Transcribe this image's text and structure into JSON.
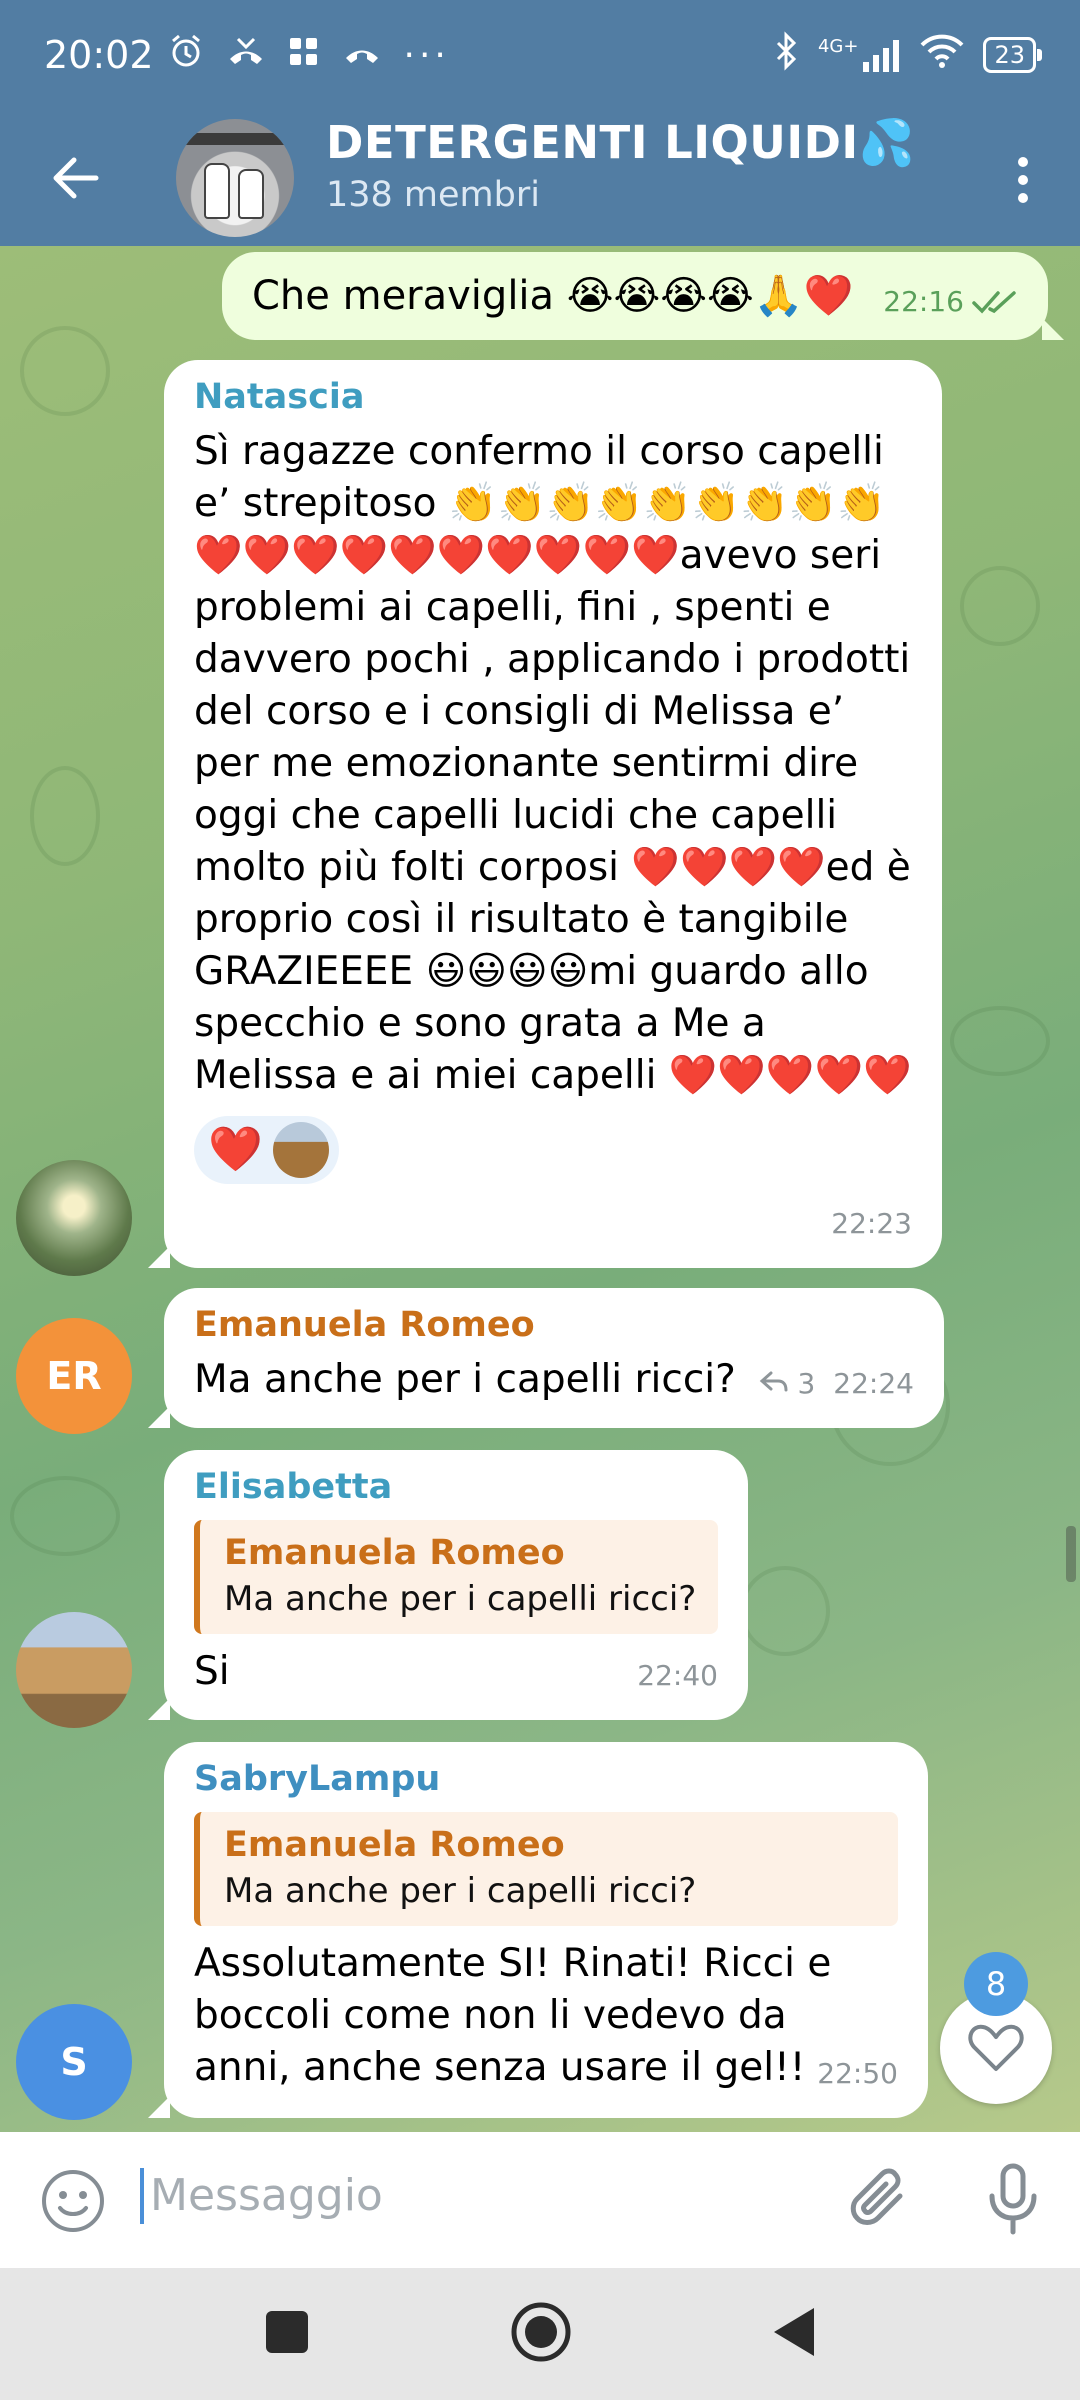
{
  "status_bar": {
    "time": "20:02",
    "network": "4G+",
    "battery": "23"
  },
  "header": {
    "title": "DETERGENTI LIQUIDI💦",
    "subtitle": "138 membri"
  },
  "messages": [
    {
      "type": "outgoing",
      "text": "Che meraviglia 😭😭😭😭🙏❤️",
      "time": "22:16"
    },
    {
      "type": "incoming",
      "sender": "Natascia",
      "sender_color": "#3f9dc0",
      "text": "Sì ragazze confermo il corso capelli e’ strepitoso 👏👏👏👏👏👏👏👏👏❤️❤️❤️❤️❤️❤️❤️❤️❤️❤️avevo seri problemi ai capelli, fini , spenti e davvero pochi , applicando i prodotti del corso e i consigli di Melissa e’ per me emozionante sentirmi dire oggi che capelli lucidi che capelli molto più folti corposi ❤️❤️❤️❤️ed è proprio così il risultato è tangibile GRAZIEEEE 😃😃😃😃mi guardo allo specchio e sono grata a Me a Melissa e ai miei capelli ❤️❤️❤️❤️❤️",
      "reaction": "❤️",
      "time": "22:23"
    },
    {
      "type": "incoming",
      "sender": "Emanuela Romeo",
      "sender_color": "#c96f19",
      "avatar_initials": "ER",
      "text": "Ma anche per i capelli ricci?",
      "reply_count": "3",
      "time": "22:24"
    },
    {
      "type": "incoming",
      "sender": "Elisabetta",
      "sender_color": "#3f9dc0",
      "reply_to": {
        "name": "Emanuela Romeo",
        "text": "Ma anche per i capelli ricci?"
      },
      "text": "Si",
      "time": "22:40"
    },
    {
      "type": "incoming",
      "sender": "SabryLampu",
      "sender_color": "#3f8fc0",
      "avatar_initials": "S",
      "reply_to": {
        "name": "Emanuela Romeo",
        "text": "Ma anche per i capelli ricci?"
      },
      "text": "Assolutamente SI! Rinati! Ricci e boccoli come non li vedevo da anni, anche senza usare il gel!!",
      "time": "22:50"
    }
  ],
  "reactions_fab": {
    "badge": "8",
    "icon": "heart-icon"
  },
  "input": {
    "placeholder": "Messaggio"
  },
  "colors": {
    "header": "#527da3",
    "outgoing_bubble": "#effedd",
    "accent_blue": "#4d9be0",
    "er_avatar": "#f3923a",
    "s_avatar": "#4a90e2"
  }
}
